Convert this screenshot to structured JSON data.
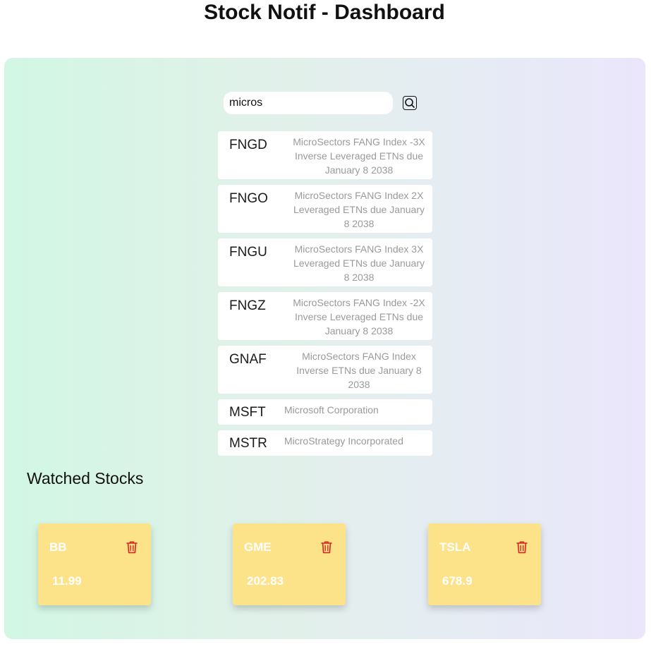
{
  "header": {
    "title": "Stock Notif - Dashboard"
  },
  "search": {
    "value": "micros"
  },
  "results": [
    {
      "symbol": "FNGD",
      "name": "MicroSectors FANG Index -3X Inverse Leveraged ETNs due January 8 2038"
    },
    {
      "symbol": "FNGO",
      "name": "MicroSectors FANG Index 2X Leveraged ETNs due January 8 2038"
    },
    {
      "symbol": "FNGU",
      "name": "MicroSectors FANG Index 3X Leveraged ETNs due January 8 2038"
    },
    {
      "symbol": "FNGZ",
      "name": "MicroSectors FANG Index -2X Inverse Leveraged ETNs due January 8 2038"
    },
    {
      "symbol": "GNAF",
      "name": "MicroSectors FANG Index Inverse ETNs due January 8 2038"
    },
    {
      "symbol": "MSFT",
      "name": "Microsoft Corporation"
    },
    {
      "symbol": "MSTR",
      "name": "MicroStrategy Incorporated"
    }
  ],
  "watched": {
    "heading": "Watched Stocks",
    "stocks": [
      {
        "symbol": "BB",
        "price": "11.99"
      },
      {
        "symbol": "GME",
        "price": "202.83"
      },
      {
        "symbol": "TSLA",
        "price": "678.9"
      }
    ]
  },
  "colors": {
    "card_bg": "#fce38a",
    "delete_icon": "#e0201b",
    "panel_left": "#d2f7e4",
    "panel_right": "#ebe6fb"
  },
  "icons": {
    "search_button": "magnifier-icon",
    "delete_button": "trash-icon"
  }
}
